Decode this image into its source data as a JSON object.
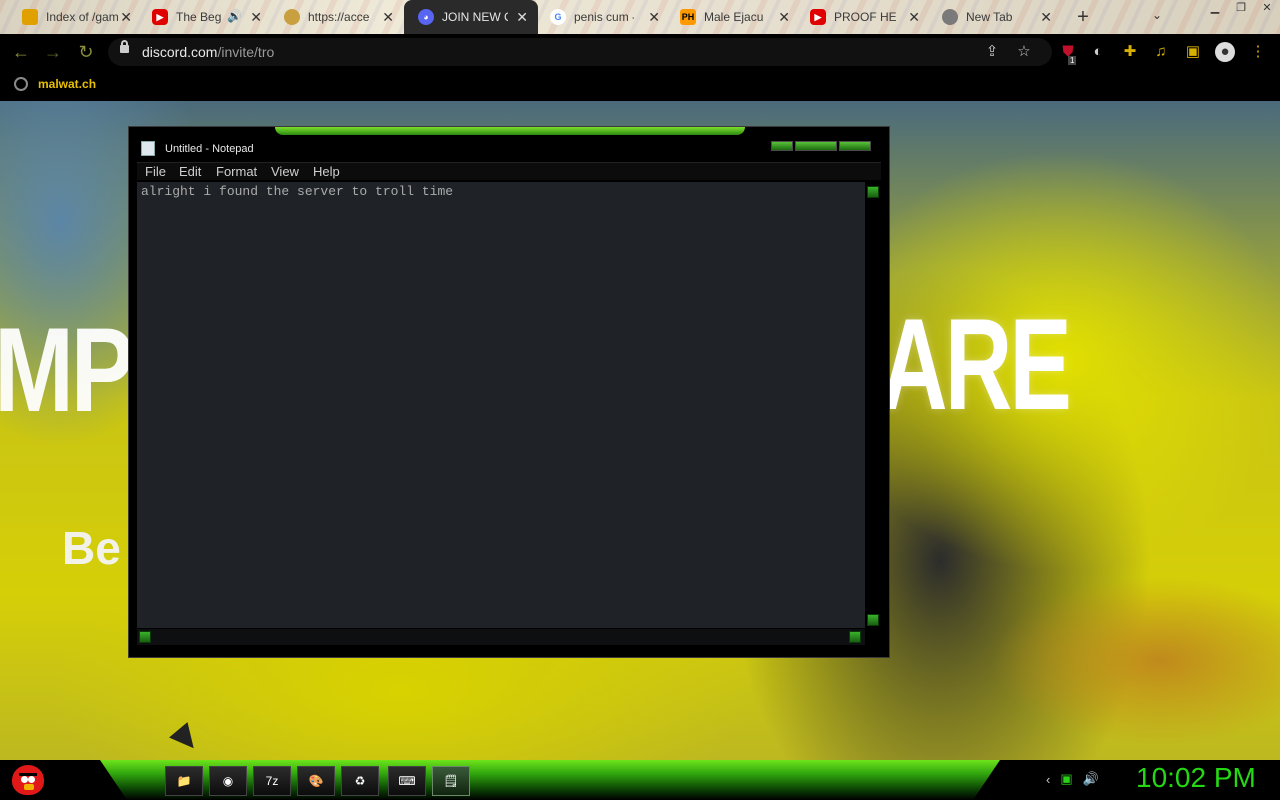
{
  "browser": {
    "tabs": [
      {
        "title": "Index of /gam",
        "favicon": "emoji-icon",
        "color": "#e0a000",
        "muted": false
      },
      {
        "title": "The Beg",
        "favicon": "youtube-icon",
        "color": "#e00000",
        "muted": true
      },
      {
        "title": "https://acce",
        "favicon": "cloud-icon",
        "color": "#c8a040",
        "muted": false
      },
      {
        "title": "JOIN NEW C",
        "favicon": "discord-icon",
        "color": "#5865f2",
        "muted": false,
        "active": true
      },
      {
        "title": "penis cum -",
        "favicon": "google-icon",
        "color": "#4285f4",
        "muted": false
      },
      {
        "title": "Male Ejacu",
        "favicon": "ph-icon",
        "fav_text": "PH",
        "color": "#ff9900",
        "muted": false
      },
      {
        "title": "PROOF HE",
        "favicon": "youtube-icon",
        "color": "#e00000",
        "muted": false
      },
      {
        "title": "New Tab",
        "favicon": "chrome-icon",
        "color": "#7a7a7a",
        "muted": false
      }
    ],
    "url_host": "discord.com",
    "url_path": "/invite/tro",
    "bookmark": "malwat.ch",
    "extension_badge": "1"
  },
  "page": {
    "banner_left": "MP",
    "banner_right": "ARE",
    "banner_sub": "Be"
  },
  "notepad": {
    "title": "Untitled - Notepad",
    "menu": [
      "File",
      "Edit",
      "Format",
      "View",
      "Help"
    ],
    "content": "alright i found the server to troll time"
  },
  "taskbar": {
    "apps": [
      {
        "name": "file-explorer-icon",
        "glyph": "📁"
      },
      {
        "name": "chrome-icon",
        "glyph": "◉"
      },
      {
        "name": "7zip-icon",
        "glyph": "7z"
      },
      {
        "name": "paint-icon",
        "glyph": "🎨"
      },
      {
        "name": "recycle-icon",
        "glyph": "♻"
      },
      {
        "name": "keyboard-icon",
        "glyph": "⌨"
      },
      {
        "name": "notepad-icon",
        "glyph": "🗒"
      }
    ],
    "clock": "10:02 PM"
  }
}
